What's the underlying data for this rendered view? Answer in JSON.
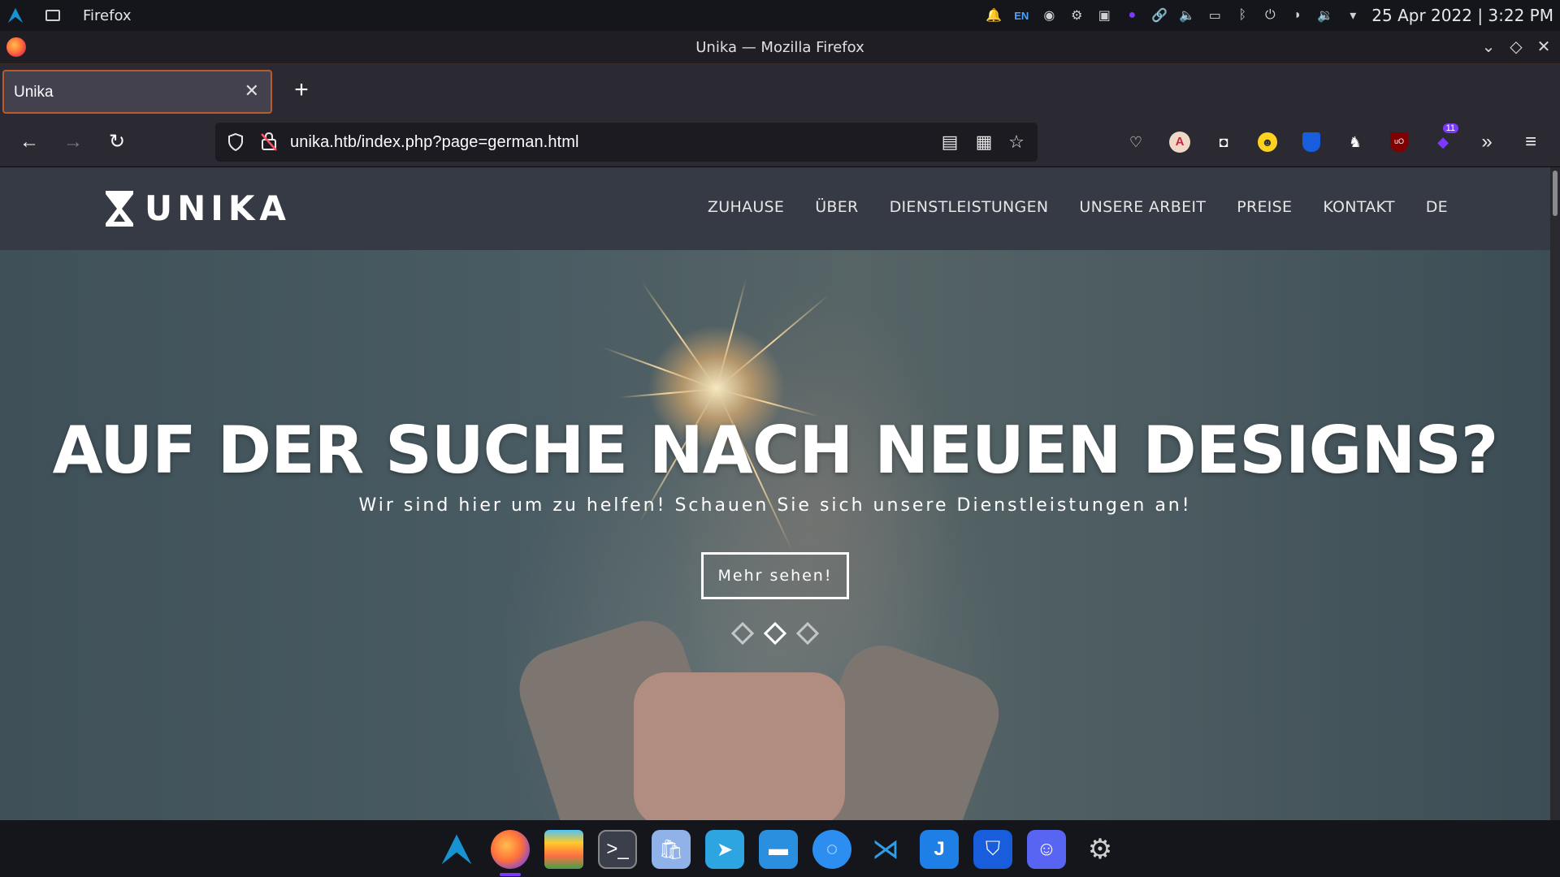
{
  "system_bar": {
    "app_name": "Firefox",
    "lang": "EN",
    "clock": "25 Apr 2022 | 3:22 PM"
  },
  "window": {
    "title": "Unika — Mozilla Firefox"
  },
  "tabs": [
    {
      "label": "Unika",
      "active": true
    }
  ],
  "toolbar": {
    "url": "unika.htb/index.php?page=german.html",
    "extension_badge": "11"
  },
  "site": {
    "logo": "UNIKA",
    "nav": [
      "ZUHAUSE",
      "ÜBER",
      "DIENSTLEISTUNGEN",
      "UNSERE ARBEIT",
      "PREISE",
      "KONTAKT",
      "DE"
    ],
    "hero": {
      "title": "AUF DER SUCHE NACH NEUEN DESIGNS?",
      "subtitle": "Wir sind hier um zu helfen! Schauen Sie sich unsere Dienstleistungen an!",
      "button": "Mehr sehen!",
      "slides": 3,
      "active_slide": 2
    }
  },
  "colors": {
    "accent": "#7b39ff",
    "tab_border": "#b85b2e",
    "header_bg": "#363a44"
  },
  "dock": {
    "apps": [
      "arch-linux",
      "firefox",
      "layers",
      "terminal",
      "files-bag",
      "telegram",
      "folder",
      "signal",
      "vscode",
      "joplin",
      "bitwarden",
      "discord",
      "settings"
    ]
  }
}
